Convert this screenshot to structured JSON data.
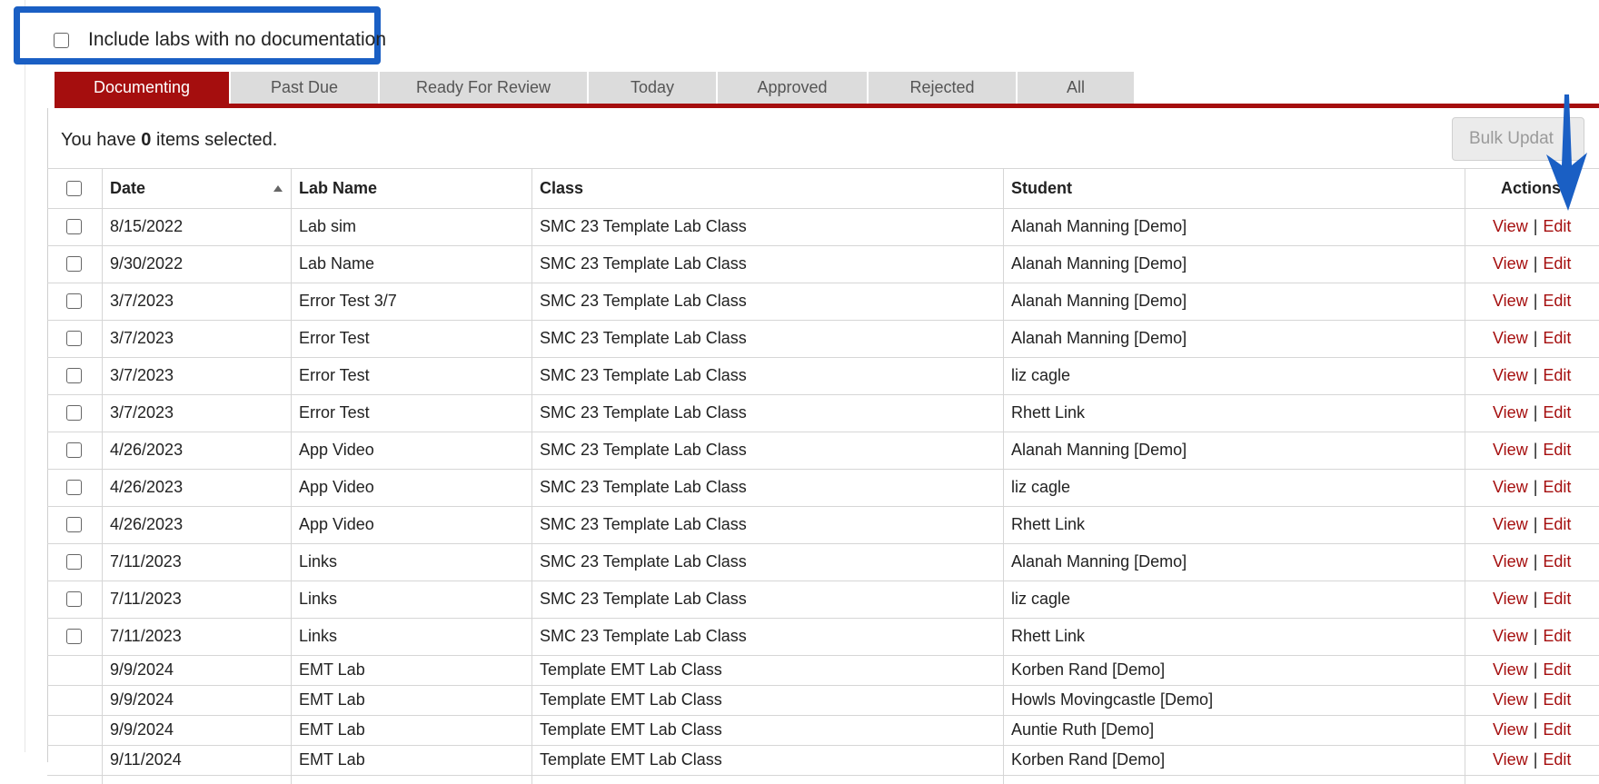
{
  "filter": {
    "include_no_doc_label": "Include labs with no documentation",
    "include_no_doc_checked": false
  },
  "tabs": [
    {
      "label": "Documenting",
      "active": true
    },
    {
      "label": "Past Due"
    },
    {
      "label": "Ready For Review"
    },
    {
      "label": "Today"
    },
    {
      "label": "Approved"
    },
    {
      "label": "Rejected"
    },
    {
      "label": "All"
    }
  ],
  "selection": {
    "prefix": "You have",
    "count": "0",
    "suffix": "items selected."
  },
  "bulk_update_label": "Bulk Updat",
  "table": {
    "columns": [
      "Date",
      "Lab Name",
      "Class",
      "Student",
      "Actions"
    ],
    "sorted_by": "Date",
    "action_view": "View",
    "action_sep": "|",
    "action_edit": "Edit",
    "rows": [
      {
        "date": "8/15/2022",
        "lab": "Lab sim",
        "class": "SMC 23 Template Lab Class",
        "student": "Alanah Manning [Demo]",
        "checkbox": true
      },
      {
        "date": "9/30/2022",
        "lab": "Lab Name",
        "class": "SMC 23 Template Lab Class",
        "student": "Alanah Manning [Demo]",
        "checkbox": true
      },
      {
        "date": "3/7/2023",
        "lab": "Error Test 3/7",
        "class": "SMC 23 Template Lab Class",
        "student": "Alanah Manning [Demo]",
        "checkbox": true
      },
      {
        "date": "3/7/2023",
        "lab": "Error Test",
        "class": "SMC 23 Template Lab Class",
        "student": "Alanah Manning [Demo]",
        "checkbox": true
      },
      {
        "date": "3/7/2023",
        "lab": "Error Test",
        "class": "SMC 23 Template Lab Class",
        "student": "liz cagle",
        "checkbox": true
      },
      {
        "date": "3/7/2023",
        "lab": "Error Test",
        "class": "SMC 23 Template Lab Class",
        "student": "Rhett Link",
        "checkbox": true
      },
      {
        "date": "4/26/2023",
        "lab": "App Video",
        "class": "SMC 23 Template Lab Class",
        "student": "Alanah Manning [Demo]",
        "checkbox": true
      },
      {
        "date": "4/26/2023",
        "lab": "App Video",
        "class": "SMC 23 Template Lab Class",
        "student": "liz cagle",
        "checkbox": true
      },
      {
        "date": "4/26/2023",
        "lab": "App Video",
        "class": "SMC 23 Template Lab Class",
        "student": "Rhett Link",
        "checkbox": true
      },
      {
        "date": "7/11/2023",
        "lab": "Links",
        "class": "SMC 23 Template Lab Class",
        "student": "Alanah Manning [Demo]",
        "checkbox": true
      },
      {
        "date": "7/11/2023",
        "lab": "Links",
        "class": "SMC 23 Template Lab Class",
        "student": "liz cagle",
        "checkbox": true
      },
      {
        "date": "7/11/2023",
        "lab": "Links",
        "class": "SMC 23 Template Lab Class",
        "student": "Rhett Link",
        "checkbox": true
      },
      {
        "date": "9/9/2024",
        "lab": "EMT Lab",
        "class": "Template EMT Lab Class",
        "student": "Korben Rand [Demo]",
        "checkbox": false
      },
      {
        "date": "9/9/2024",
        "lab": "EMT Lab",
        "class": "Template EMT Lab Class",
        "student": "Howls Movingcastle [Demo]",
        "checkbox": false
      },
      {
        "date": "9/9/2024",
        "lab": "EMT Lab",
        "class": "Template EMT Lab Class",
        "student": "Auntie Ruth [Demo]",
        "checkbox": false
      },
      {
        "date": "9/11/2024",
        "lab": "EMT Lab",
        "class": "Template EMT Lab Class",
        "student": "Korben Rand [Demo]",
        "checkbox": false
      }
    ]
  },
  "colors": {
    "accent": "#a50e0e",
    "highlight_blue": "#1a5fc4"
  }
}
